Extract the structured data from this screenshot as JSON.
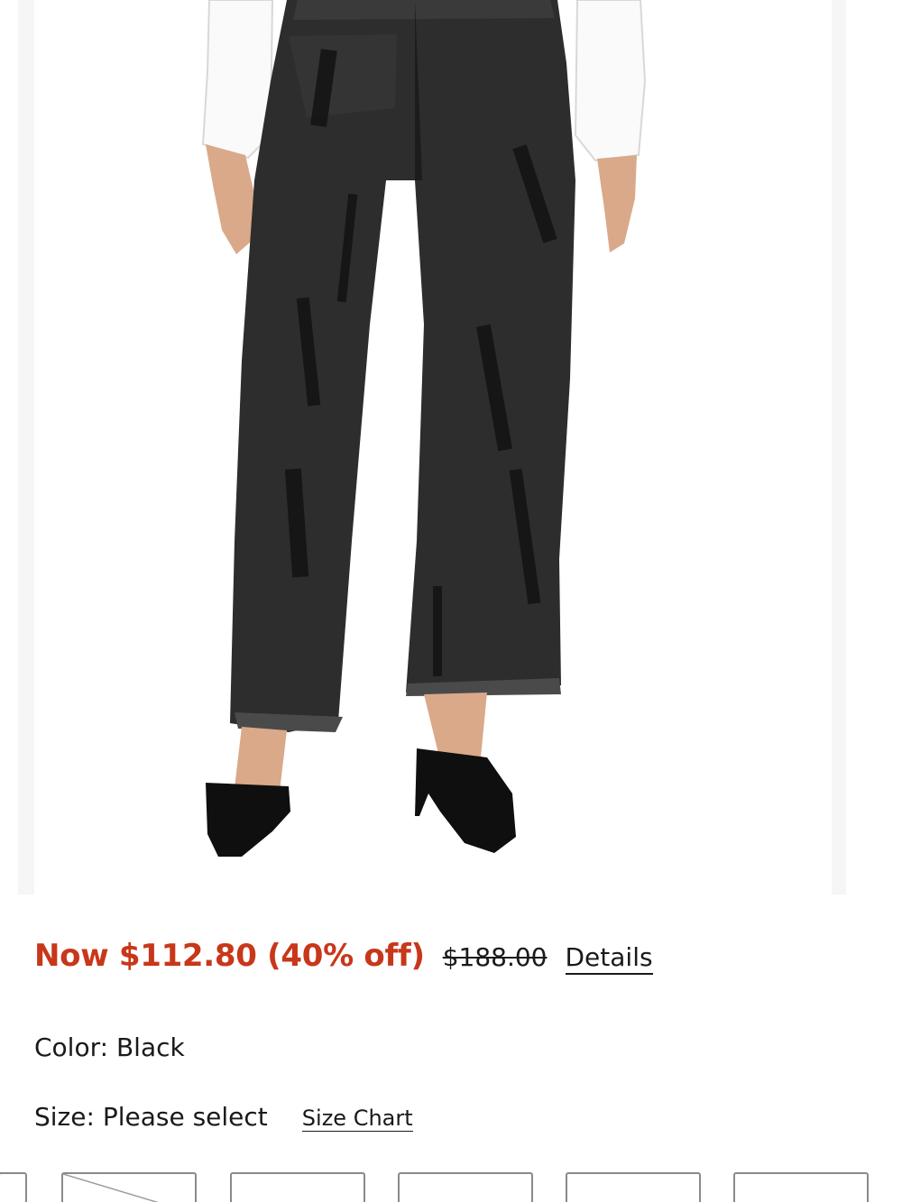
{
  "pricing": {
    "sale_price": "Now $112.80 (40% off)",
    "original_price": "$188.00",
    "details_link": "Details",
    "sale_color": "#c8371a"
  },
  "color": {
    "label": "Color:",
    "value": "Black"
  },
  "size": {
    "label": "Size:",
    "value": "Please select",
    "chart_link": "Size Chart"
  },
  "product_image": {
    "icon": "product-photo-black-barrel-jeans"
  }
}
